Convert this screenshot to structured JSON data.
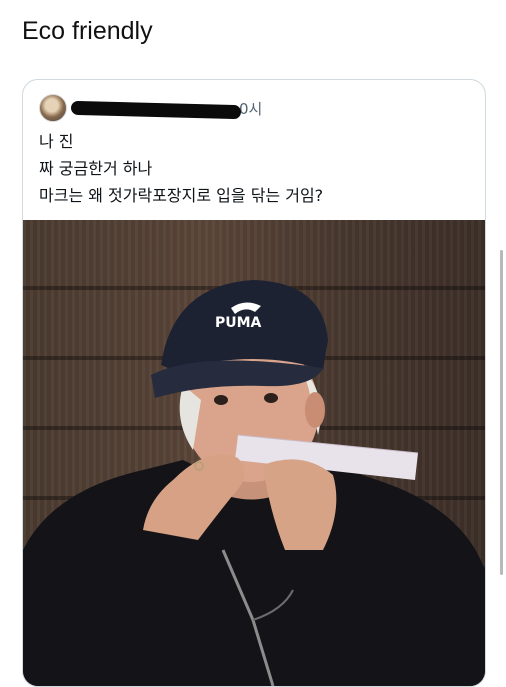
{
  "post": {
    "text": "Eco friendly"
  },
  "quoted_tweet": {
    "avatar_icon": "profile-avatar",
    "time_suffix": "0시",
    "lines": [
      "나 진",
      "짜 궁금한거 하나",
      "마크는 왜 젓가락포장지로 입을 닦는 거임?"
    ],
    "cap_logo": "PUMA"
  },
  "colors": {
    "border": "#cfd9de",
    "text": "#0f1419",
    "secondary": "#536471"
  }
}
